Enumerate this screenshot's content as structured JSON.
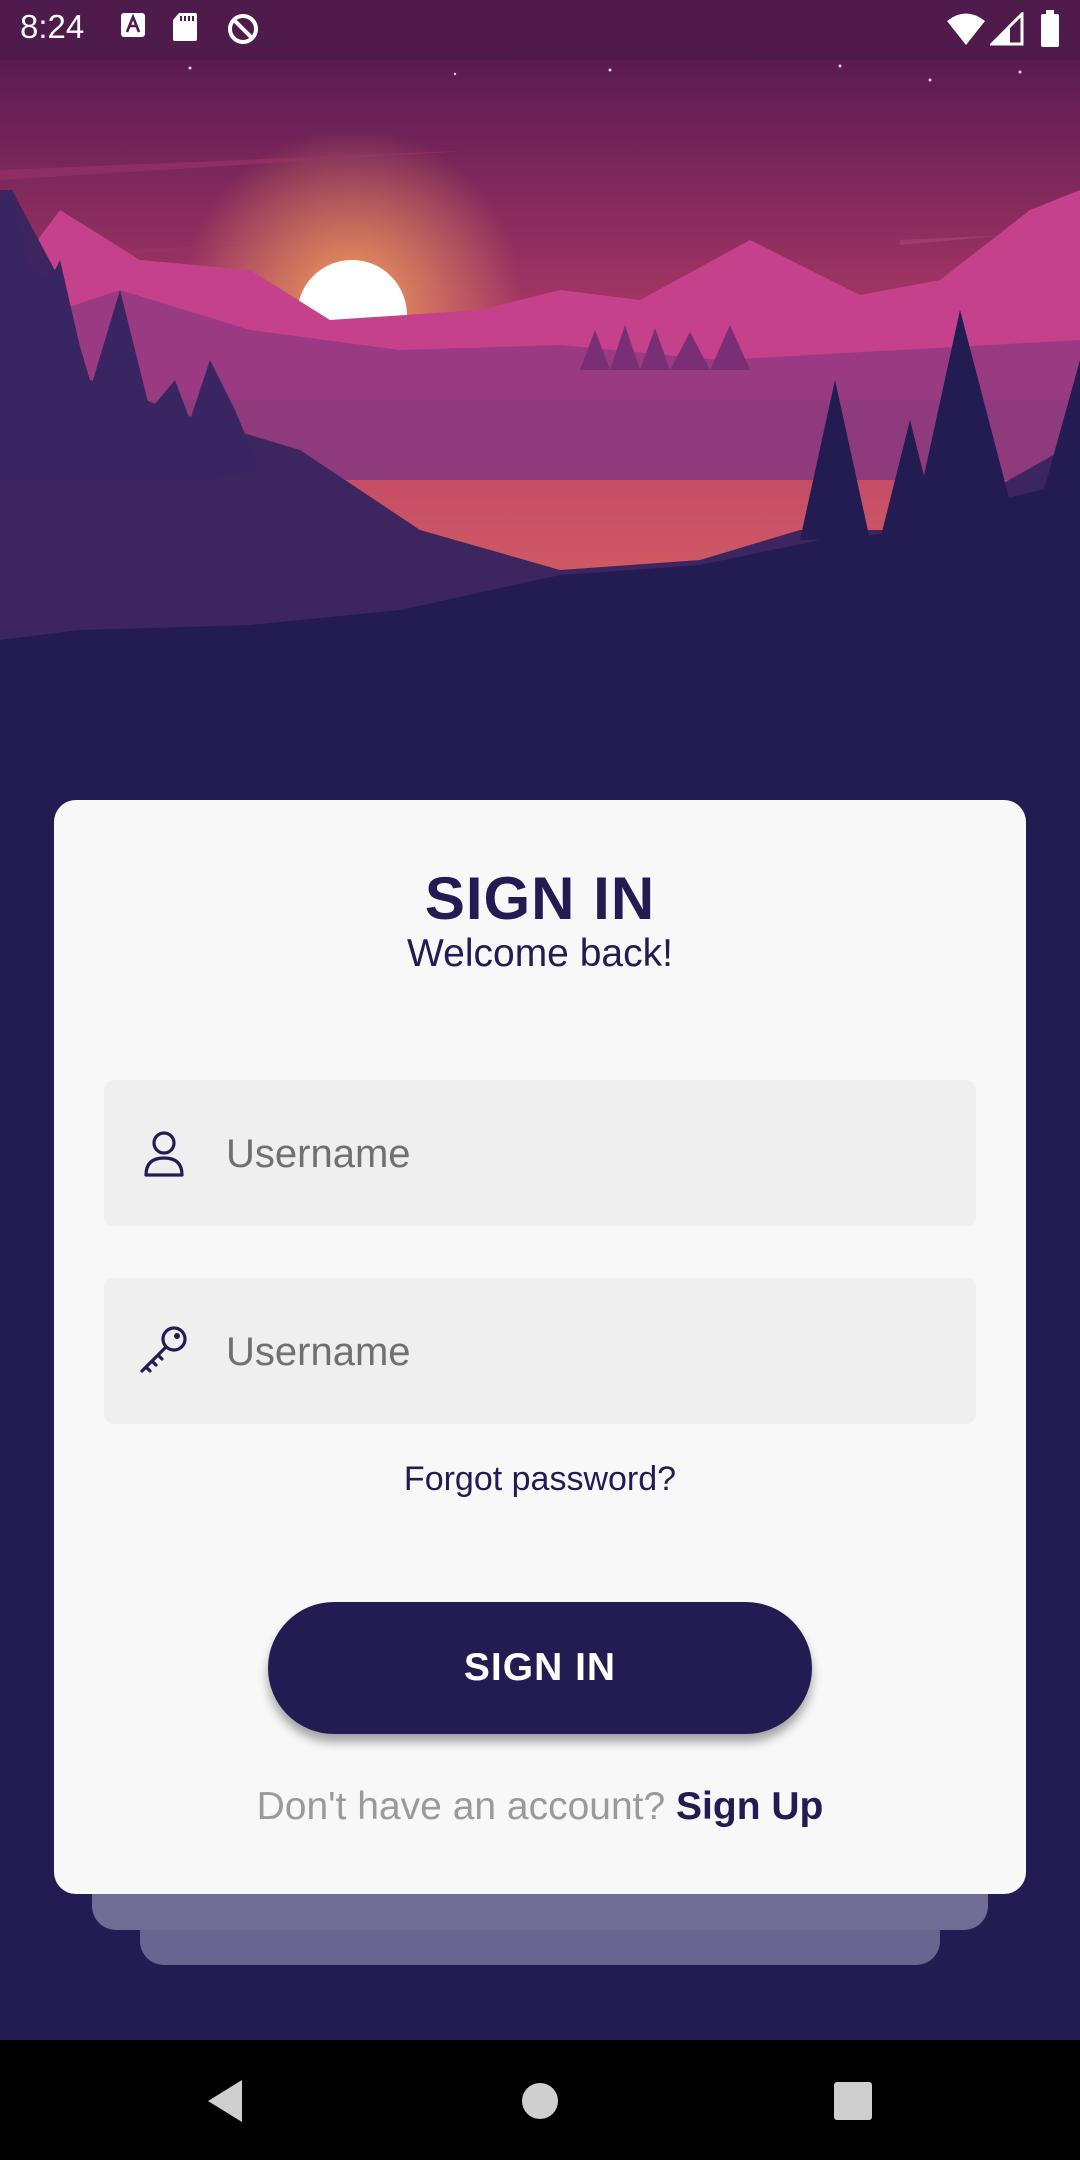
{
  "status_bar": {
    "time": "8:24",
    "left_icons": [
      "a-badge-icon",
      "sd-card-icon",
      "data-saver-icon"
    ],
    "right_icons": [
      "wifi-icon",
      "signal-icon",
      "battery-icon"
    ]
  },
  "login_card": {
    "title": "SIGN IN",
    "subtitle": "Welcome back!",
    "username_field": {
      "placeholder": "Username",
      "icon": "user-icon"
    },
    "password_field": {
      "placeholder": "Username",
      "icon": "key-icon"
    },
    "forgot_password": "Forgot password?",
    "sign_in_button": "SIGN IN",
    "signup_prompt": "Don't have an account?",
    "signup_link": "Sign Up"
  },
  "nav_bar": {
    "buttons": [
      "back-icon",
      "home-icon",
      "recents-icon"
    ]
  },
  "colors": {
    "primary": "#221c53",
    "status_bar": "#4f1a4c",
    "card": "#f8f8f8",
    "field": "#efefef",
    "muted_text": "#9a9a9a"
  }
}
